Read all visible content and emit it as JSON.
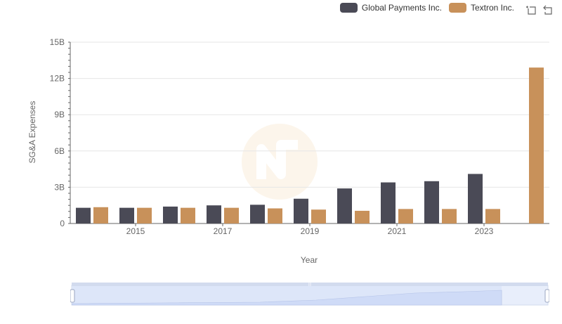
{
  "chart_data": {
    "type": "bar",
    "categories": [
      "2014",
      "2015",
      "2016",
      "2017",
      "2018",
      "2019",
      "2020",
      "2021",
      "2022",
      "2023",
      "2024"
    ],
    "x_tick_labels": [
      "2015",
      "2017",
      "2019",
      "2021",
      "2023"
    ],
    "series": [
      {
        "name": "Global Payments Inc.",
        "color": "#4a4a56",
        "values": [
          1.3,
          1.3,
          1.4,
          1.5,
          1.55,
          2.05,
          2.9,
          3.4,
          3.5,
          4.1,
          null
        ]
      },
      {
        "name": "Textron Inc.",
        "color": "#c8915a",
        "values": [
          1.35,
          1.3,
          1.3,
          1.3,
          1.25,
          1.15,
          1.05,
          1.2,
          1.2,
          1.2,
          12.9
        ]
      }
    ],
    "xlabel": "Year",
    "ylabel": "SG&A Expenses",
    "ylim": [
      0,
      15
    ],
    "y_ticks": [
      0,
      3,
      6,
      9,
      12,
      15
    ],
    "y_tick_labels": [
      "0",
      "3B",
      "6B",
      "9B",
      "12B",
      "15B"
    ],
    "grid": true,
    "legend_position": "top-right"
  },
  "toolbox": {
    "zoom_icon": "zoom-select-icon",
    "restore_icon": "restore-icon"
  },
  "slider": {
    "start": 0,
    "end": 100
  }
}
